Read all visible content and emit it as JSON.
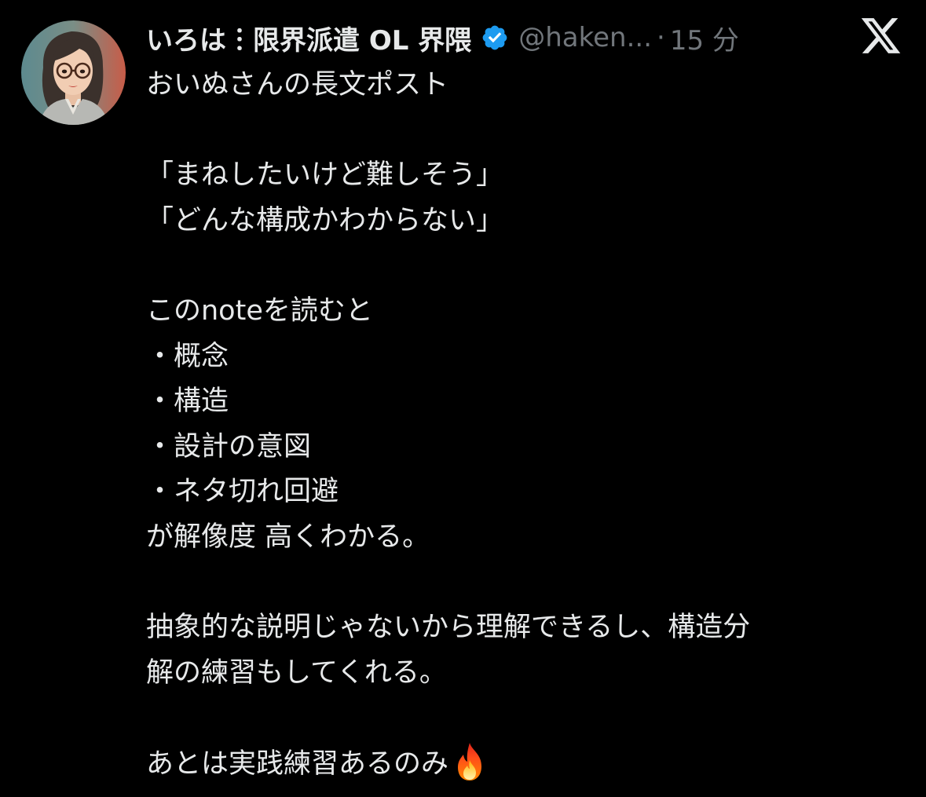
{
  "tweet": {
    "author": {
      "display_name": "いろは︙限界派遣 OL 界隈",
      "handle": "@haken...",
      "verified": true,
      "avatar": "illustrated-woman-with-glasses-avatar"
    },
    "separator": "·",
    "timestamp": "15 分",
    "platform_icon": "x-logo-icon",
    "body_lines": [
      "おいぬさんの長文ポスト",
      "",
      "「まねしたいけど難しそう」",
      "「どんな構成かわからない」",
      "",
      "このnoteを読むと",
      "・概念",
      "・構造",
      "・設計の意図",
      "・ネタ切れ回避",
      "が解像度 高くわかる。",
      "",
      "抽象的な説明じゃないから理解できるし、構造分",
      "解の練習もしてくれる。",
      "",
      "あとは実践練習あるのみ"
    ],
    "trailing_emoji": "fire-icon"
  },
  "colors": {
    "background": "#000000",
    "primary_text": "#e7e9ea",
    "secondary_text": "#71767b",
    "verified_badge": "#1d9bf0"
  }
}
